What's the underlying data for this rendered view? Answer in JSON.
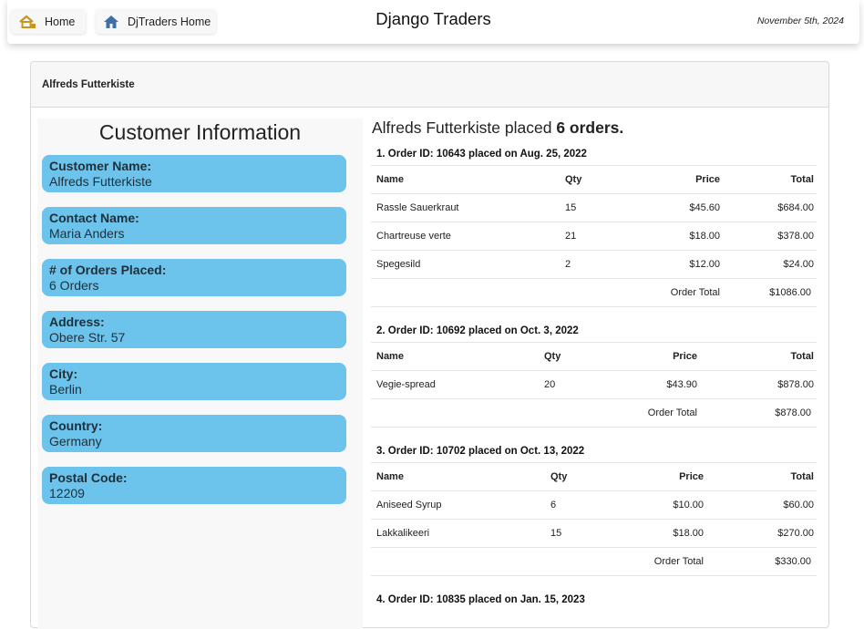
{
  "nav": {
    "home_label": "Home",
    "dj_label": "DjTraders Home"
  },
  "app": {
    "title": "Django Traders",
    "date": "November 5th, 2024"
  },
  "card_header": "Alfreds Futterkiste",
  "customer_info": {
    "title": "Customer Information",
    "fields": [
      {
        "label": "Customer Name:",
        "value": "Alfreds Futterkiste"
      },
      {
        "label": "Contact Name:",
        "value": "Maria Anders"
      },
      {
        "label": "# of Orders Placed:",
        "value": "6 Orders"
      },
      {
        "label": "Address:",
        "value": "Obere Str. 57"
      },
      {
        "label": "City:",
        "value": "Berlin"
      },
      {
        "label": "Country:",
        "value": "Germany"
      },
      {
        "label": "Postal Code:",
        "value": "12209"
      }
    ]
  },
  "summary": {
    "prefix": "Alfreds Futterkiste placed",
    "count": "6 orders."
  },
  "columns": {
    "name": "Name",
    "qty": "Qty",
    "price": "Price",
    "total": "Total"
  },
  "order_total_label": "Order Total",
  "orders": [
    {
      "title": "1. Order ID: 10643 placed on Aug. 25, 2022",
      "items": [
        {
          "name": "Rassle Sauerkraut",
          "qty": "15",
          "price": "$45.60",
          "total": "$684.00"
        },
        {
          "name": "Chartreuse verte",
          "qty": "21",
          "price": "$18.00",
          "total": "$378.00"
        },
        {
          "name": "Spegesild",
          "qty": "2",
          "price": "$12.00",
          "total": "$24.00"
        }
      ],
      "order_total": "$1086.00"
    },
    {
      "title": "2. Order ID: 10692 placed on Oct. 3, 2022",
      "items": [
        {
          "name": "Vegie-spread",
          "qty": "20",
          "price": "$43.90",
          "total": "$878.00"
        }
      ],
      "order_total": "$878.00"
    },
    {
      "title": "3. Order ID: 10702 placed on Oct. 13, 2022",
      "items": [
        {
          "name": "Aniseed Syrup",
          "qty": "6",
          "price": "$10.00",
          "total": "$60.00"
        },
        {
          "name": "Lakkalikeeri",
          "qty": "15",
          "price": "$18.00",
          "total": "$270.00"
        }
      ],
      "order_total": "$330.00"
    },
    {
      "title": "4. Order ID: 10835 placed on Jan. 15, 2023",
      "items": [],
      "order_total": ""
    }
  ],
  "colors": {
    "pill": "#6cc3eb",
    "home_icon": "#c8961e",
    "dj_icon": "#3f6fa8"
  },
  "icons": {
    "home": "house-icon",
    "dj": "house-icon"
  }
}
